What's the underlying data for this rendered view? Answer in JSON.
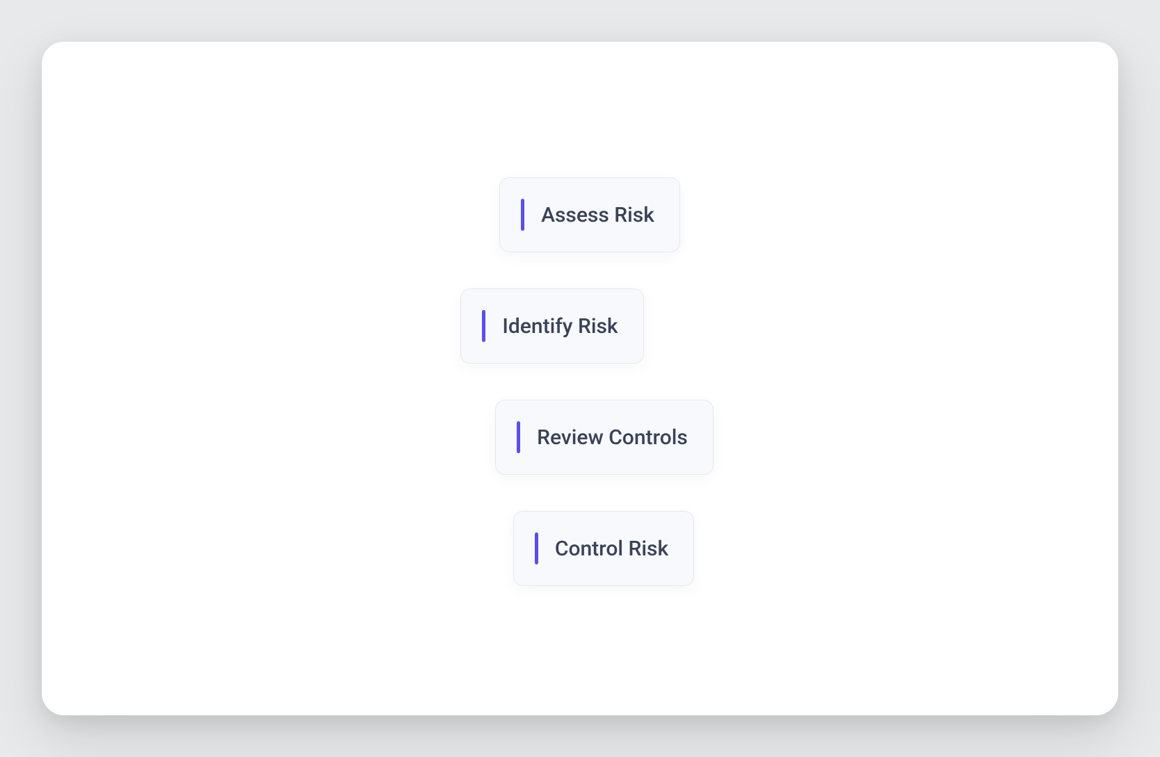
{
  "steps": [
    {
      "label": "Assess Risk"
    },
    {
      "label": "Identify Risk"
    },
    {
      "label": "Review Controls"
    },
    {
      "label": "Control Risk"
    }
  ],
  "colors": {
    "accent": "#5b4ee8",
    "card_bg": "#f7f9fc",
    "text": "#3a4257"
  }
}
